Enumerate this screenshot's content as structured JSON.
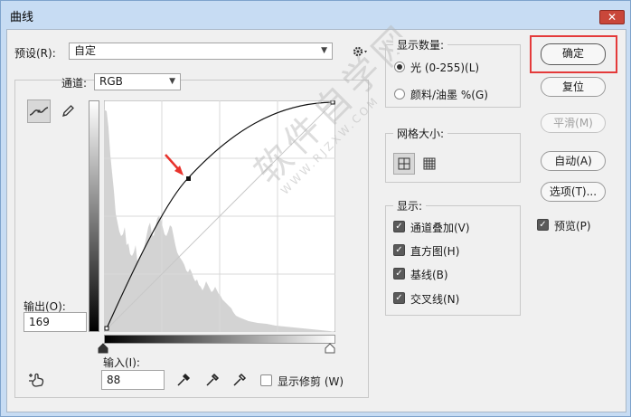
{
  "window": {
    "title": "曲线",
    "close_symbol": "✕"
  },
  "preset": {
    "label": "预设(R):",
    "value": "自定"
  },
  "channel": {
    "label": "通道:",
    "value": "RGB"
  },
  "output": {
    "label": "输出(O):",
    "value": "169"
  },
  "input": {
    "label": "输入(I):",
    "value": "88"
  },
  "display_amount": {
    "title": "显示数量:",
    "options": [
      {
        "label": "光 (0-255)(L)",
        "selected": true
      },
      {
        "label": "颜料/油墨 %(G)",
        "selected": false
      }
    ]
  },
  "grid_size": {
    "title": "网格大小:"
  },
  "show": {
    "title": "显示:",
    "options": [
      {
        "label": "通道叠加(V)",
        "checked": true
      },
      {
        "label": "直方图(H)",
        "checked": true
      },
      {
        "label": "基线(B)",
        "checked": true
      },
      {
        "label": "交叉线(N)",
        "checked": true
      }
    ]
  },
  "show_clipping": {
    "label": "显示修剪 (W)",
    "checked": false
  },
  "buttons": {
    "ok": "确定",
    "reset": "复位",
    "smooth": "平滑(M)",
    "auto": "自动(A)",
    "options": "选项(T)..."
  },
  "preview": {
    "label": "预览(P)",
    "checked": true
  },
  "watermark": {
    "main": "软件自学网",
    "sub": "WWW.RJZXW.COM"
  },
  "colors": {
    "highlight": "#e43a3a",
    "arrow": "#e8332d"
  }
}
